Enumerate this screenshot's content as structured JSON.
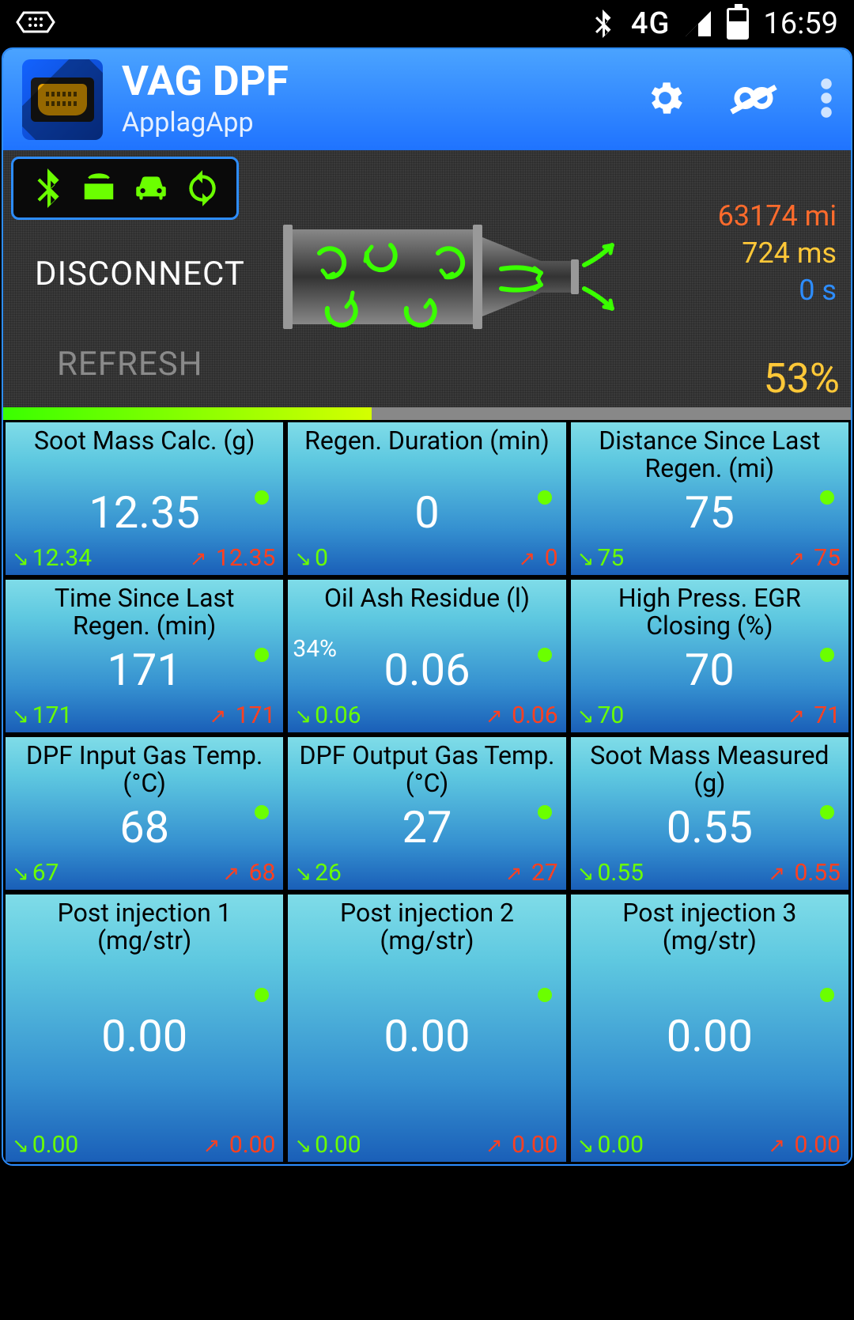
{
  "status_bar": {
    "network": "4G",
    "time": "16:59"
  },
  "header": {
    "title": "VAG DPF",
    "subtitle": "ApplagApp"
  },
  "top_panel": {
    "disconnect": "DISCONNECT",
    "refresh": "REFRESH",
    "distance": "63174 mi",
    "latency": "724 ms",
    "timer": "0 s",
    "percent": "53%",
    "progress_pct": 53
  },
  "tiles": [
    {
      "label": "Soot Mass Calc. (g)",
      "value": "12.35",
      "min": "12.34",
      "max": "12.35",
      "extra": ""
    },
    {
      "label": "Regen. Duration (min)",
      "value": "0",
      "min": "0",
      "max": "0",
      "extra": ""
    },
    {
      "label": "Distance Since Last Regen. (mi)",
      "value": "75",
      "min": "75",
      "max": "75",
      "extra": ""
    },
    {
      "label": "Time Since Last Regen. (min)",
      "value": "171",
      "min": "171",
      "max": "171",
      "extra": ""
    },
    {
      "label": "Oil Ash Residue (l)",
      "value": "0.06",
      "min": "0.06",
      "max": "0.06",
      "extra": "34%"
    },
    {
      "label": "High Press. EGR Closing (%)",
      "value": "70",
      "min": "70",
      "max": "71",
      "extra": ""
    },
    {
      "label": "DPF Input Gas Temp. (°C)",
      "value": "68",
      "min": "67",
      "max": "68",
      "extra": ""
    },
    {
      "label": "DPF Output Gas Temp. (°C)",
      "value": "27",
      "min": "26",
      "max": "27",
      "extra": ""
    },
    {
      "label": "Soot Mass Measured (g)",
      "value": "0.55",
      "min": "0.55",
      "max": "0.55",
      "extra": ""
    },
    {
      "label": "Post injection 1 (mg/str)",
      "value": "0.00",
      "min": "0.00",
      "max": "0.00",
      "extra": ""
    },
    {
      "label": "Post injection 2 (mg/str)",
      "value": "0.00",
      "min": "0.00",
      "max": "0.00",
      "extra": ""
    },
    {
      "label": "Post injection 3 (mg/str)",
      "value": "0.00",
      "min": "0.00",
      "max": "0.00",
      "extra": ""
    }
  ]
}
